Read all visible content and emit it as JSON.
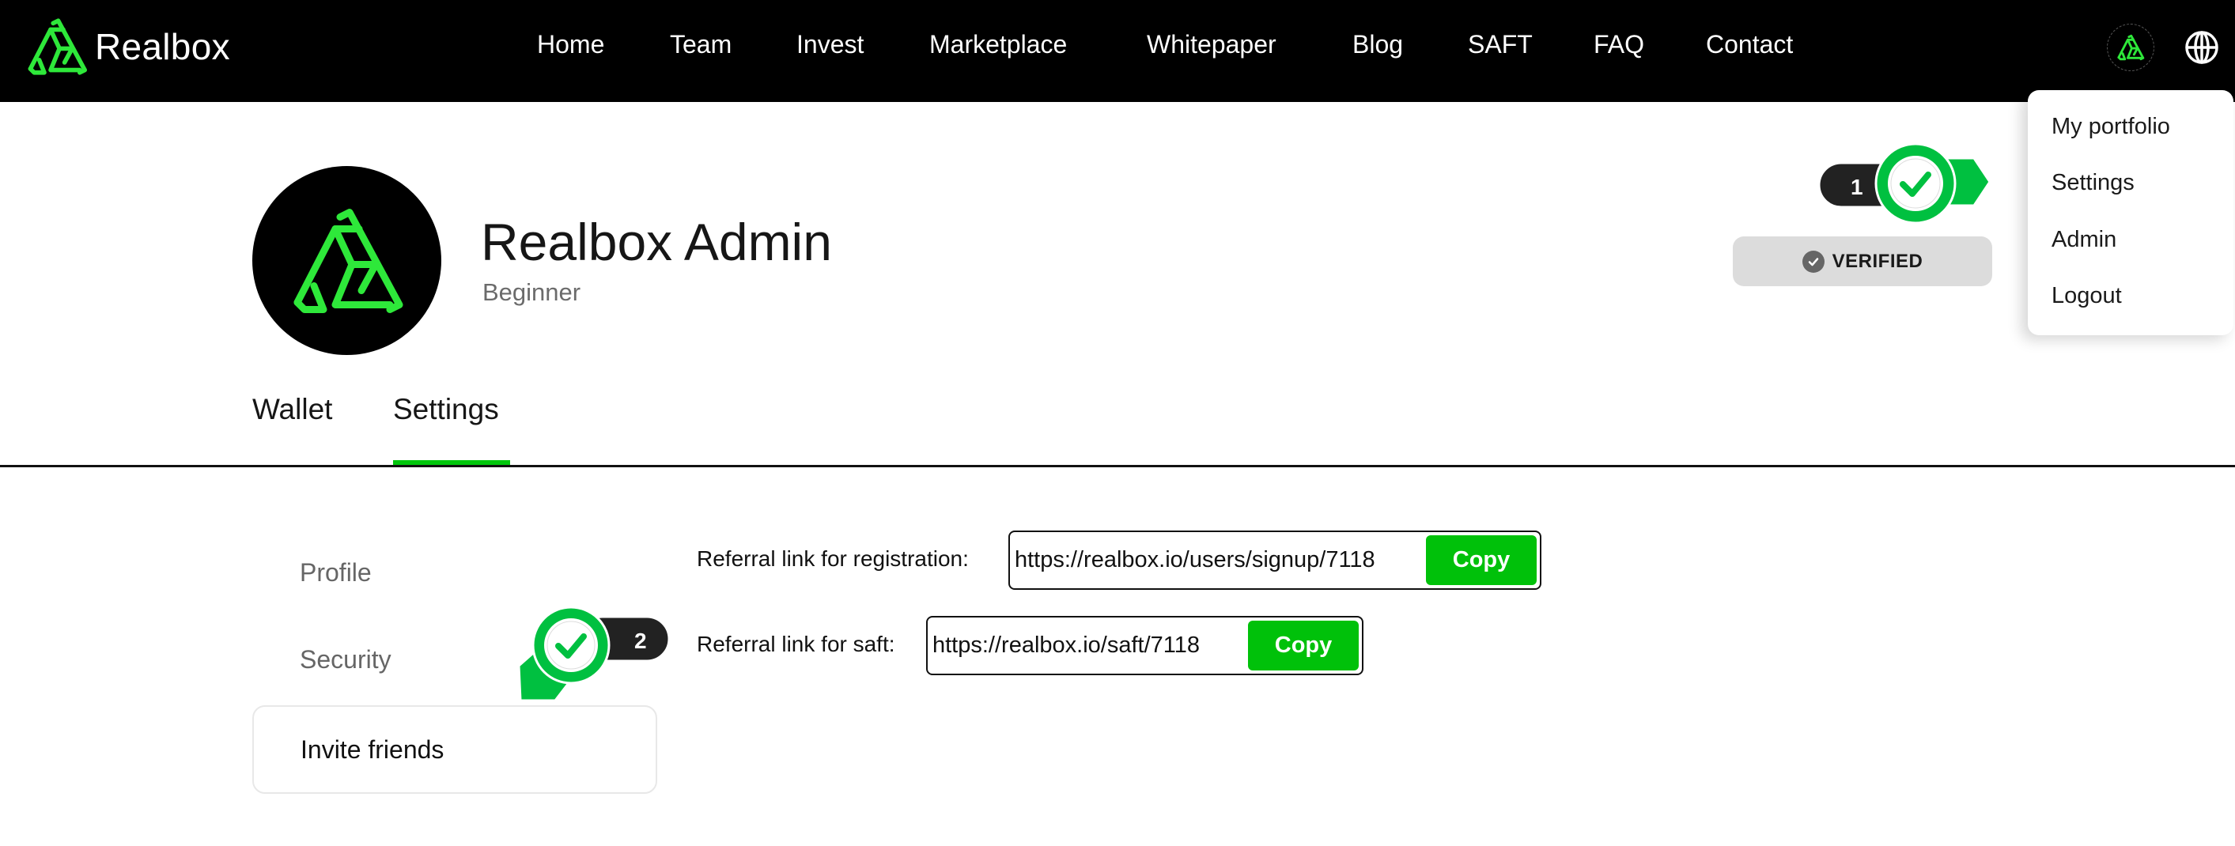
{
  "header": {
    "brand": "Realbox",
    "nav": [
      {
        "label": "Home"
      },
      {
        "label": "Team"
      },
      {
        "label": "Invest"
      },
      {
        "label": "Marketplace"
      },
      {
        "label": "Whitepaper"
      },
      {
        "label": "Blog"
      },
      {
        "label": "SAFT"
      },
      {
        "label": "FAQ"
      },
      {
        "label": "Contact"
      }
    ],
    "user_avatar_icon": "realbox-logo-icon",
    "language_icon": "globe-icon"
  },
  "user_menu": {
    "items": [
      {
        "label": "My portfolio"
      },
      {
        "label": "Settings"
      },
      {
        "label": "Admin"
      },
      {
        "label": "Logout"
      }
    ]
  },
  "profile": {
    "name": "Realbox Admin",
    "level": "Beginner",
    "status_badge": "VERIFIED",
    "status_icon": "check-circle-icon"
  },
  "markers": [
    {
      "number": "1",
      "icon": "checkmark-icon"
    },
    {
      "number": "2",
      "icon": "checkmark-icon"
    }
  ],
  "tabs": [
    {
      "label": "Wallet",
      "active": false
    },
    {
      "label": "Settings",
      "active": true
    }
  ],
  "settings_menu": {
    "items": [
      {
        "label": "Profile",
        "active": false
      },
      {
        "label": "Security",
        "active": false
      },
      {
        "label": "Invite friends",
        "active": true
      }
    ]
  },
  "invite": {
    "rows": [
      {
        "label": "Referral link for registration:",
        "value": "https://realbox.io/users/signup/7118",
        "button": "Copy"
      },
      {
        "label": "Referral link for saft:",
        "value": "https://realbox.io/saft/7118",
        "button": "Copy"
      }
    ]
  },
  "colors": {
    "brand_green": "#00c10a",
    "logo_green": "#2ee83a",
    "marker_green": "#00c040",
    "nav_bg": "#000000"
  }
}
